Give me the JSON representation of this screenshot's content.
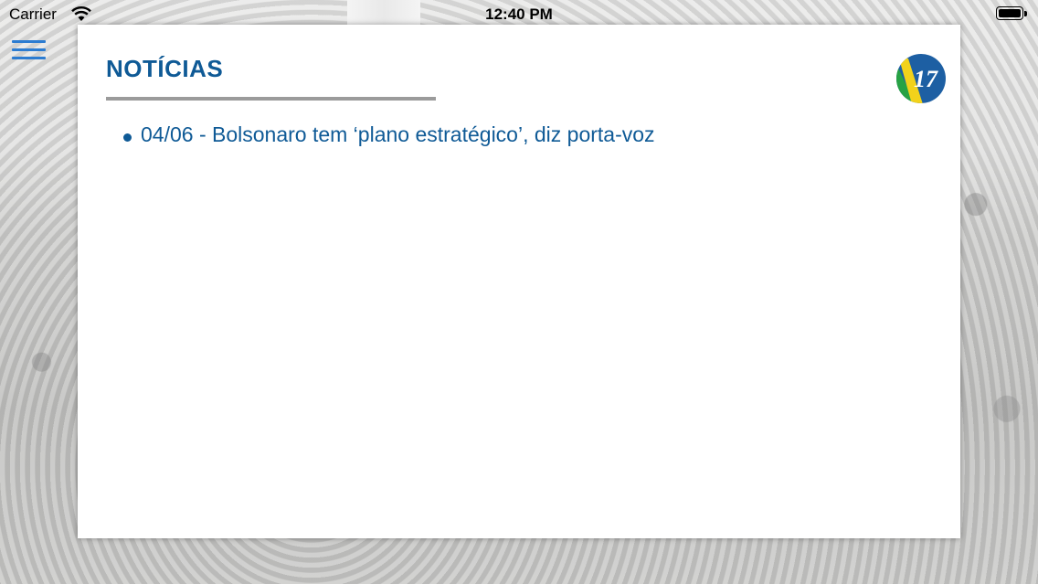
{
  "status_bar": {
    "carrier": "Carrier",
    "time": "12:40 PM"
  },
  "nav": {
    "menu_icon": "hamburger-icon"
  },
  "page": {
    "title": "NOTÍCIAS",
    "logo_text": "17",
    "accent_color": "#0f5a96"
  },
  "news": {
    "items": [
      {
        "text": "04/06 - Bolsonaro tem ‘plano estratégico’, diz porta-voz"
      }
    ]
  }
}
